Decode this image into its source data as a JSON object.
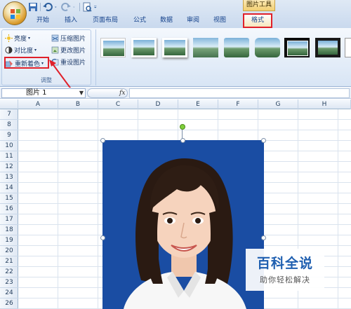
{
  "title_tabs": {
    "contextual_group": "图片工具",
    "tabs": [
      "开始",
      "插入",
      "页面布局",
      "公式",
      "数据",
      "审阅",
      "视图"
    ],
    "active_tab": "格式"
  },
  "ribbon": {
    "adjust_group": {
      "label": "调整",
      "brightness": "亮度",
      "contrast": "对比度",
      "recolor": "重新着色",
      "compress": "压缩图片",
      "change_picture": "更改图片",
      "reset_picture": "重设图片"
    },
    "picture_styles_count": 8
  },
  "formula_bar": {
    "name_box": "图片 1",
    "fx": "fx",
    "formula_value": ""
  },
  "grid": {
    "columns": [
      "A",
      "B",
      "C",
      "D",
      "E",
      "F",
      "G",
      "H"
    ],
    "rows": [
      "7",
      "8",
      "9",
      "10",
      "11",
      "12",
      "13",
      "14",
      "15",
      "16",
      "17",
      "18",
      "19",
      "20",
      "21",
      "22",
      "23",
      "24",
      "25",
      "26"
    ]
  },
  "watermark": {
    "title": "百科全说",
    "subtitle": "助你轻松解决"
  },
  "colors": {
    "highlight_red": "#e0202a",
    "photo_background": "#1a4da3",
    "watermark_blue": "#1f5fb0"
  }
}
